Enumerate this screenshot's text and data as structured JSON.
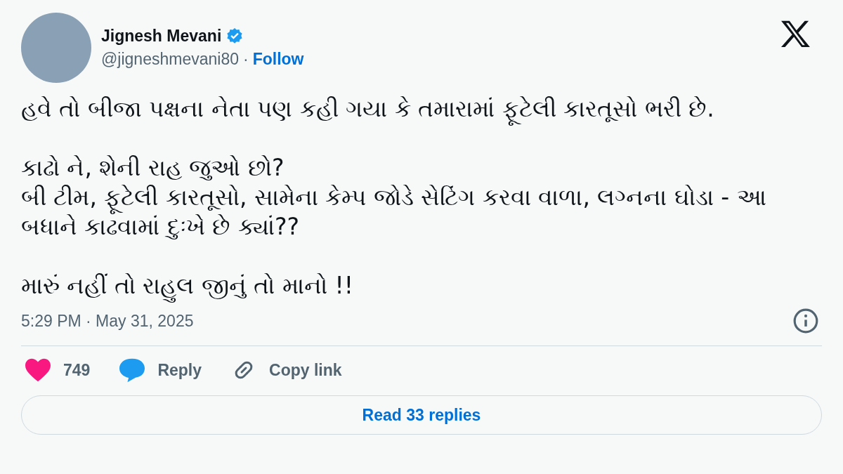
{
  "author": {
    "name": "Jignesh Mevani",
    "verified": true,
    "handle": "@jigneshmevani80",
    "separator": "·",
    "follow": "Follow"
  },
  "paragraphs": [
    [
      "હવે તો બીજા પક્ષના નેતા પણ કહી ગયા કે તમારામાં ફૂટેલી કારતૂસો ભરી છે."
    ],
    [
      "કાઢો ને, શેની રાહ જુઓ છો?",
      "બી ટીમ, ફૂટેલી કારતૂસો, સામેના કેમ્પ જોડે સેટિંગ કરવા વાળા, લગ્નના ઘોડા - આ બધાને કાઢવામાં દુઃખે છે ક્યાં??"
    ],
    [
      "મારું નહીં તો રાહુલ જીનું તો માનો !!"
    ]
  ],
  "timestamp": "5:29 PM · May 31, 2025",
  "actions": [
    {
      "kind": "like",
      "label": "749"
    },
    {
      "kind": "reply",
      "label": "Reply"
    },
    {
      "kind": "copy",
      "label": "Copy link"
    }
  ],
  "read_replies": "Read 33 replies"
}
